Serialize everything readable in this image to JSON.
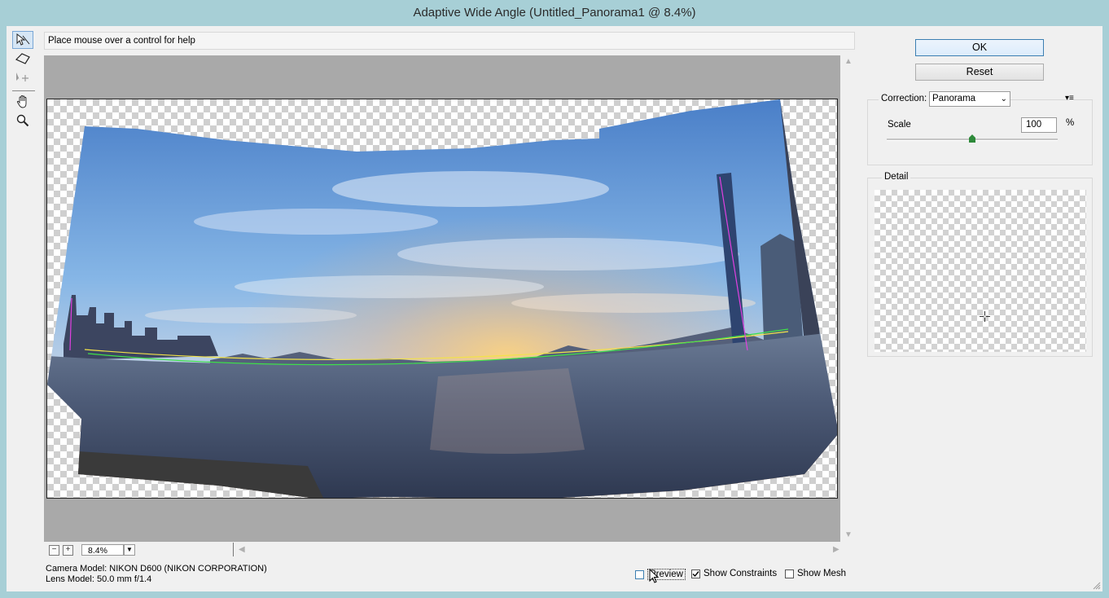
{
  "window": {
    "title": "Adaptive Wide Angle (Untitled_Panorama1 @ 8.4%)"
  },
  "toolbar": {
    "tools": [
      {
        "name": "constraint-tool-icon",
        "active": true
      },
      {
        "name": "polygon-constraint-tool-icon",
        "active": false
      },
      {
        "name": "move-tool-icon",
        "active": false
      },
      {
        "name": "hand-tool-icon",
        "active": false
      },
      {
        "name": "zoom-tool-icon",
        "active": false
      }
    ]
  },
  "help": {
    "text": "Place mouse over a control for help"
  },
  "zoom": {
    "minus": "−",
    "plus": "+",
    "value": "8.4%"
  },
  "info": {
    "camera": "Camera Model: NIKON D600 (NIKON CORPORATION)",
    "lens": "Lens Model: 50.0 mm f/1.4"
  },
  "options": {
    "preview_label": "Preview",
    "preview_checked": false,
    "constraints_label": "Show Constraints",
    "constraints_checked": true,
    "mesh_label": "Show Mesh",
    "mesh_checked": false
  },
  "buttons": {
    "ok": "OK",
    "reset": "Reset"
  },
  "correction": {
    "label": "Correction:",
    "value": "Panorama",
    "scale_label": "Scale",
    "scale_value": "100",
    "scale_unit": "%",
    "scale_fraction": 0.5
  },
  "detail": {
    "label": "Detail"
  },
  "colors": {
    "constraint_yellow": "#f2e24a",
    "constraint_green": "#3ee04a",
    "constraint_magenta": "#e040e0",
    "accent": "#3c7fb1"
  }
}
